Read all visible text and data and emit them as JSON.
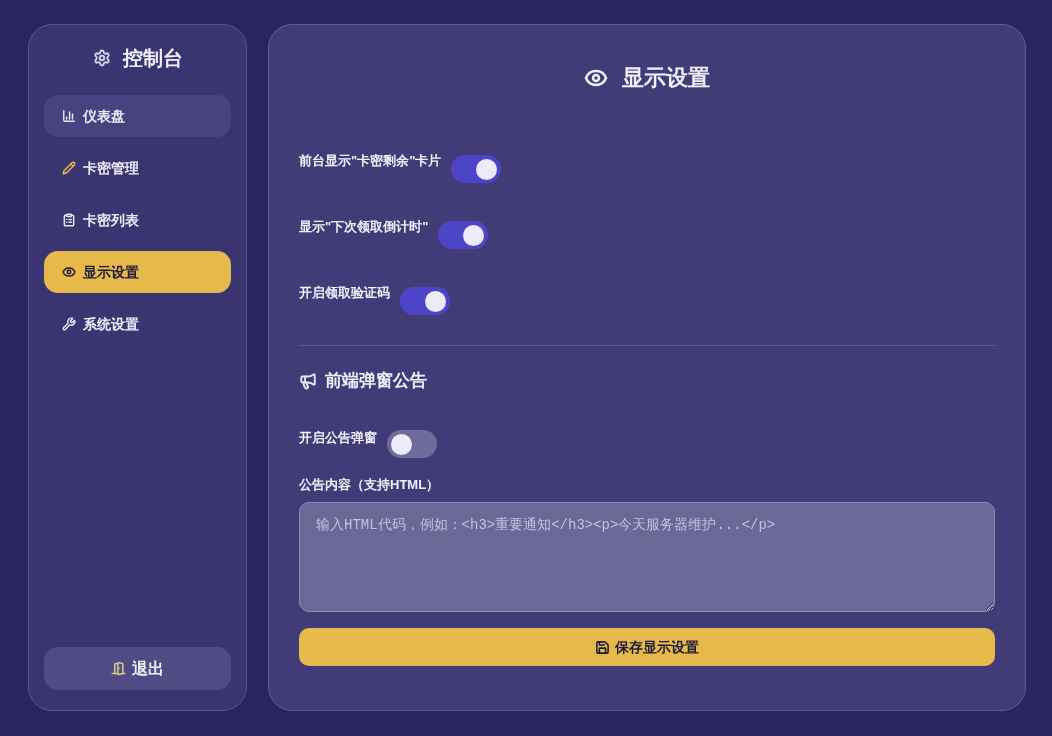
{
  "sidebar": {
    "title": "控制台",
    "items": [
      {
        "label": "仪表盘",
        "selected": false,
        "hovered": true
      },
      {
        "label": "卡密管理",
        "selected": false,
        "hovered": false
      },
      {
        "label": "卡密列表",
        "selected": false,
        "hovered": false
      },
      {
        "label": "显示设置",
        "selected": true,
        "hovered": false
      },
      {
        "label": "系统设置",
        "selected": false,
        "hovered": false
      }
    ],
    "logout_button": "退出"
  },
  "main": {
    "title": "显示设置",
    "toggles": [
      {
        "label": "前台显示\"卡密剩余\"卡片",
        "on": true
      },
      {
        "label": "显示\"下次领取倒计时\"",
        "on": true
      },
      {
        "label": "开启领取验证码",
        "on": true
      }
    ],
    "announcement": {
      "heading": "前端弹窗公告",
      "toggle": {
        "label": "开启公告弹窗",
        "on": false
      },
      "content_label": "公告内容（支持HTML）",
      "textarea": {
        "placeholder": "输入HTML代码，例如：<h3>重要通知</h3><p>今天服务器维护...</p>"
      }
    },
    "save_button": "保存显示设置"
  }
}
